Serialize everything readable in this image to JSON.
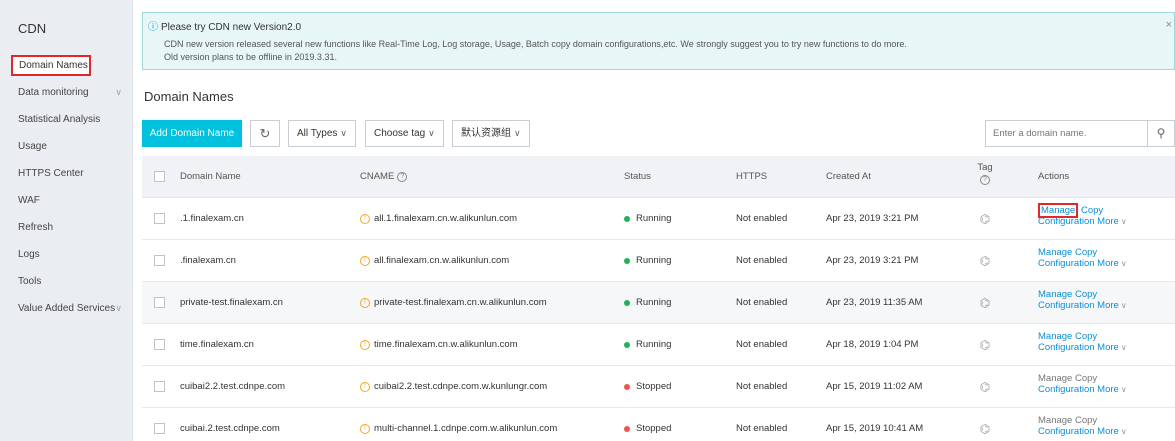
{
  "sidebar": {
    "title": "CDN",
    "items": [
      {
        "label": "Domain Names",
        "active": true,
        "chevron": false
      },
      {
        "label": "Data monitoring",
        "chevron": true
      },
      {
        "label": "Statistical Analysis",
        "chevron": false
      },
      {
        "label": "Usage",
        "chevron": false
      },
      {
        "label": "HTTPS Center",
        "chevron": false
      },
      {
        "label": "WAF",
        "chevron": false
      },
      {
        "label": "Refresh",
        "chevron": false
      },
      {
        "label": "Logs",
        "chevron": false
      },
      {
        "label": "Tools",
        "chevron": false
      },
      {
        "label": "Value Added Services",
        "chevron": true
      }
    ]
  },
  "notice": {
    "title": "Please try CDN new Version2.0",
    "line1": "CDN new version released several new functions like Real-Time Log, Log storage, Usage, Batch copy domain configurations,etc. We strongly suggest you to try new functions to do more.",
    "line2": "Old version plans to be offline in 2019.3.31.",
    "close": "×"
  },
  "page_title": "Domain Names",
  "toolbar": {
    "add_label": "Add Domain Name",
    "refresh_icon": "↻",
    "type_filter": "All Types",
    "tag_filter": "Choose tag",
    "group_filter": "默认资源组",
    "search_placeholder": "Enter a domain name.",
    "search_icon": "⚲"
  },
  "table": {
    "headers": {
      "name": "Domain Name",
      "cname": "CNAME",
      "status": "Status",
      "https": "HTTPS",
      "created": "Created At",
      "tag": "Tag",
      "actions": "Actions"
    },
    "action_labels": {
      "manage": "Manage",
      "copy": "Copy",
      "configuration": "Configuration",
      "more": "More"
    },
    "status_colors": {
      "Running": "#1fb25a",
      "Stopped": "#f1524c"
    },
    "rows": [
      {
        "name": ".1.finalexam.cn",
        "cname": "all.1.finalexam.cn.w.alikunlun.com",
        "status": "Running",
        "https": "Not enabled",
        "created": "Apr 23, 2019 3:21 PM",
        "manage_muted": false,
        "manage_highlight": true
      },
      {
        "name": ".finalexam.cn",
        "cname": "all.finalexam.cn.w.alikunlun.com",
        "status": "Running",
        "https": "Not enabled",
        "created": "Apr 23, 2019 3:21 PM",
        "manage_muted": false,
        "manage_highlight": false
      },
      {
        "name": "private-test.finalexam.cn",
        "cname": "private-test.finalexam.cn.w.alikunlun.com",
        "status": "Running",
        "https": "Not enabled",
        "created": "Apr 23, 2019 11:35 AM",
        "manage_muted": false,
        "manage_highlight": false
      },
      {
        "name": "time.finalexam.cn",
        "cname": "time.finalexam.cn.w.alikunlun.com",
        "status": "Running",
        "https": "Not enabled",
        "created": "Apr 18, 2019 1:04 PM",
        "manage_muted": false,
        "manage_highlight": false
      },
      {
        "name": "cuibai2.2.test.cdnpe.com",
        "cname": "cuibai2.2.test.cdnpe.com.w.kunlungr.com",
        "status": "Stopped",
        "https": "Not enabled",
        "created": "Apr 15, 2019 11:02 AM",
        "manage_muted": true,
        "manage_highlight": false
      },
      {
        "name": "cuibai.2.test.cdnpe.com",
        "cname": "multi-channel.1.cdnpe.com.w.alikunlun.com",
        "status": "Stopped",
        "https": "Not enabled",
        "created": "Apr 15, 2019 10:41 AM",
        "manage_muted": true,
        "manage_highlight": false
      }
    ]
  }
}
